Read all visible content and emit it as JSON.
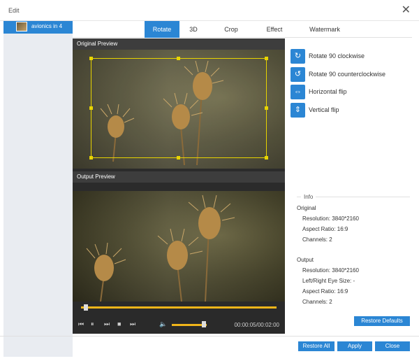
{
  "window": {
    "title": "Edit",
    "close_glyph": "✕"
  },
  "sidebar": {
    "file_name": "avionics in 4"
  },
  "tabs": [
    {
      "label": "Rotate",
      "active": true
    },
    {
      "label": "3D",
      "active": false
    },
    {
      "label": "Crop",
      "active": false
    },
    {
      "label": "Effect",
      "active": false
    },
    {
      "label": "Watermark",
      "active": false
    }
  ],
  "preview": {
    "original_label": "Original Preview",
    "output_label": "Output Preview"
  },
  "player": {
    "time": "00:00:05/00:02:00",
    "progress_fraction": 0.03,
    "volume_fraction": 0.9,
    "controls": {
      "skip_back": "⏮",
      "pause": "⏸",
      "step": "⏭",
      "stop": "■",
      "skip_fwd": "⏭",
      "volume": "🔈"
    }
  },
  "rotate_ops": [
    {
      "label": "Rotate 90 clockwise",
      "icon": "↻"
    },
    {
      "label": "Rotate 90 counterclockwise",
      "icon": "↺"
    },
    {
      "label": "Horizontal flip",
      "icon": "⇔"
    },
    {
      "label": "Vertical flip",
      "icon": "⇕"
    }
  ],
  "info": {
    "legend": "Info",
    "original_header": "Original",
    "original_resolution": "Resolution: 3840*2160",
    "original_aspect": "Aspect Ratio: 16:9",
    "original_channels": "Channels: 2",
    "output_header": "Output",
    "output_resolution": "Resolution: 3840*2160",
    "output_eye": "Left/Right Eye Size: -",
    "output_aspect": "Aspect Ratio: 16:9",
    "output_channels": "Channels: 2"
  },
  "buttons": {
    "restore_defaults": "Restore Defaults",
    "restore_all": "Restore All",
    "apply": "Apply",
    "close": "Close"
  },
  "colors": {
    "accent": "#2b86d4",
    "progress": "#f0b51a",
    "crop": "#e8d400"
  }
}
